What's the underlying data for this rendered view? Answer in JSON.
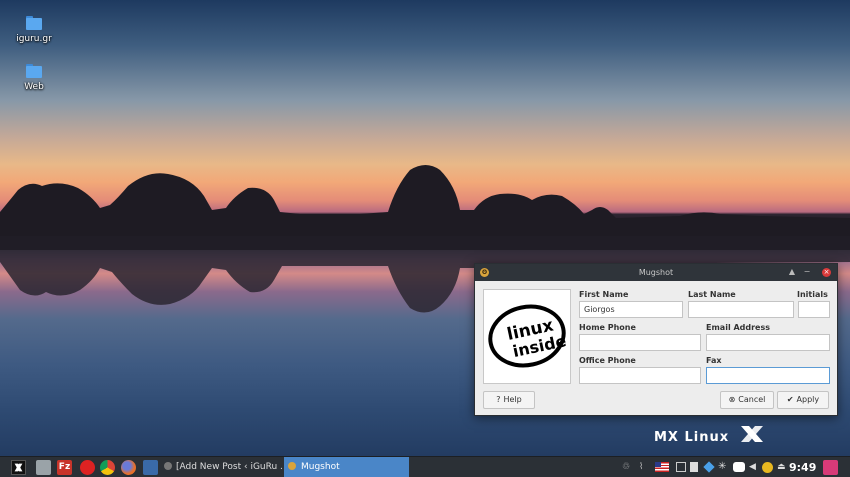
{
  "desktop": {
    "icons": [
      {
        "label": "iguru.gr",
        "icon": "folder-icon"
      },
      {
        "label": "Web",
        "icon": "folder-icon"
      }
    ],
    "brand": "MX Linux"
  },
  "dialog": {
    "title": "Mugshot",
    "photo_text_line1": "linux",
    "photo_text_line2": "inside",
    "fields": {
      "first_name_label": "First Name",
      "first_name_value": "Giorgos",
      "last_name_label": "Last Name",
      "last_name_value": "",
      "initials_label": "Initials",
      "initials_value": "",
      "home_phone_label": "Home Phone",
      "home_phone_value": "",
      "email_label": "Email Address",
      "email_value": "",
      "office_phone_label": "Office Phone",
      "office_phone_value": "",
      "fax_label": "Fax",
      "fax_value": ""
    },
    "buttons": {
      "help": "Help",
      "cancel": "Cancel",
      "apply": "Apply"
    }
  },
  "taskbar": {
    "tasks": [
      {
        "label": "[Add New Post ‹ iGuRu ..."
      },
      {
        "label": "Mugshot"
      }
    ],
    "clock": "9:49",
    "colors": {
      "active_task": "#4a86c8",
      "panel": "#2b3036"
    }
  }
}
